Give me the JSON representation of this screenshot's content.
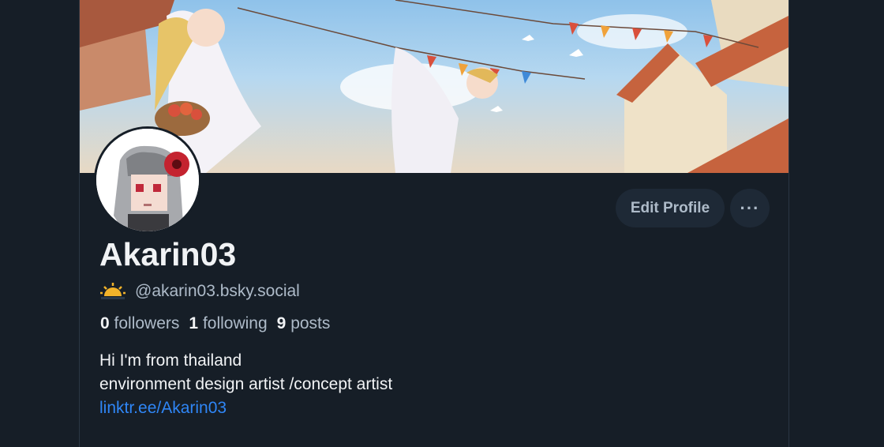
{
  "profile": {
    "display_name": "Akarin03",
    "handle": "@akarin03.bsky.social",
    "handle_icon": "sunrise-emoji-icon",
    "stats": {
      "followers_count": "0",
      "followers_label": "followers",
      "following_count": "1",
      "following_label": "following",
      "posts_count": "9",
      "posts_label": "posts"
    },
    "bio": {
      "line1": "Hi I'm from thailand",
      "line2": "environment design artist /concept artist",
      "link": "linktr.ee/Akarin03"
    }
  },
  "actions": {
    "edit_profile_label": "Edit Profile",
    "more_label": "···"
  },
  "colors": {
    "background": "#161e27",
    "button_bg": "#1e2936",
    "link": "#2f86f6",
    "muted_text": "#aebbc9",
    "primary_text": "#f1f3f5"
  }
}
